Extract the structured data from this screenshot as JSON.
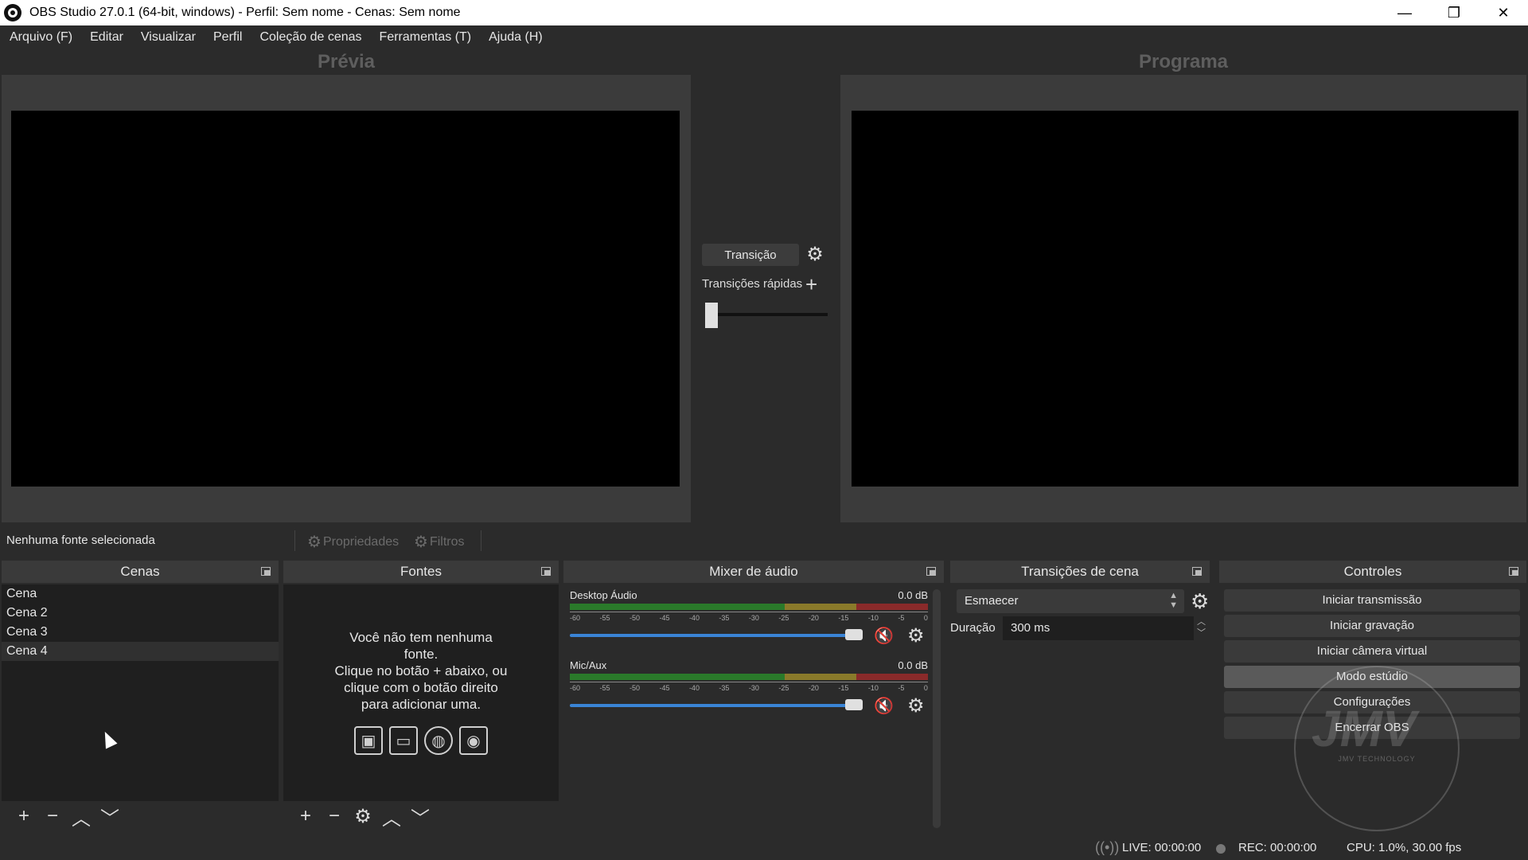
{
  "window": {
    "title": "OBS Studio 27.0.1 (64-bit, windows) - Perfil: Sem nome - Cenas: Sem nome",
    "minimize": "—",
    "maximize": "❐",
    "close": "✕"
  },
  "menu": [
    "Arquivo (F)",
    "Editar",
    "Visualizar",
    "Perfil",
    "Coleção de cenas",
    "Ferramentas (T)",
    "Ajuda (H)"
  ],
  "preview": {
    "label": "Prévia"
  },
  "program": {
    "label": "Programa"
  },
  "transition_panel": {
    "button": "Transição",
    "quick_label": "Transições rápidas",
    "t_bar_value": 0
  },
  "source_bar": {
    "no_selection": "Nenhuma fonte selecionada",
    "properties": "Propriedades",
    "filters": "Filtros"
  },
  "scenes": {
    "title": "Cenas",
    "items": [
      "Cena",
      "Cena 2",
      "Cena 3",
      "Cena 4"
    ],
    "selected_index": 3
  },
  "sources": {
    "title": "Fontes",
    "empty_lines": [
      "Você não tem nenhuma",
      "fonte.",
      "Clique no botão + abaixo, ou",
      "clique com o botão direito",
      "para adicionar uma."
    ],
    "icons": [
      "image-icon",
      "display-icon",
      "globe-icon",
      "camera-icon"
    ]
  },
  "mixer": {
    "title": "Mixer de áudio",
    "ticks": [
      "-60",
      "-55",
      "-50",
      "-45",
      "-40",
      "-35",
      "-30",
      "-25",
      "-20",
      "-15",
      "-10",
      "-5",
      "0"
    ],
    "channels": [
      {
        "name": "Desktop Áudio",
        "db": "0.0 dB",
        "volume": 1.0,
        "muted": true
      },
      {
        "name": "Mic/Aux",
        "db": "0.0 dB",
        "volume": 1.0,
        "muted": true
      }
    ]
  },
  "scene_transitions": {
    "title": "Transições de cena",
    "selected": "Esmaecer",
    "duration_label": "Duração",
    "duration_value": "300 ms"
  },
  "controls": {
    "title": "Controles",
    "buttons": [
      "Iniciar transmissão",
      "Iniciar gravação",
      "Iniciar câmera virtual",
      "Modo estúdio",
      "Configurações",
      "Encerrar OBS"
    ],
    "active_index": 3
  },
  "watermark": {
    "text": "JMV TECHNOLOGY"
  },
  "status": {
    "live": "LIVE: 00:00:00",
    "rec": "REC: 00:00:00",
    "cpu": "CPU: 1.0%, 30.00 fps"
  },
  "colors": {
    "background": "#2b2b2b",
    "dock_body": "#1f1f1f",
    "volume_blue": "#3a84d6",
    "mute_red": "#e23c3c"
  }
}
